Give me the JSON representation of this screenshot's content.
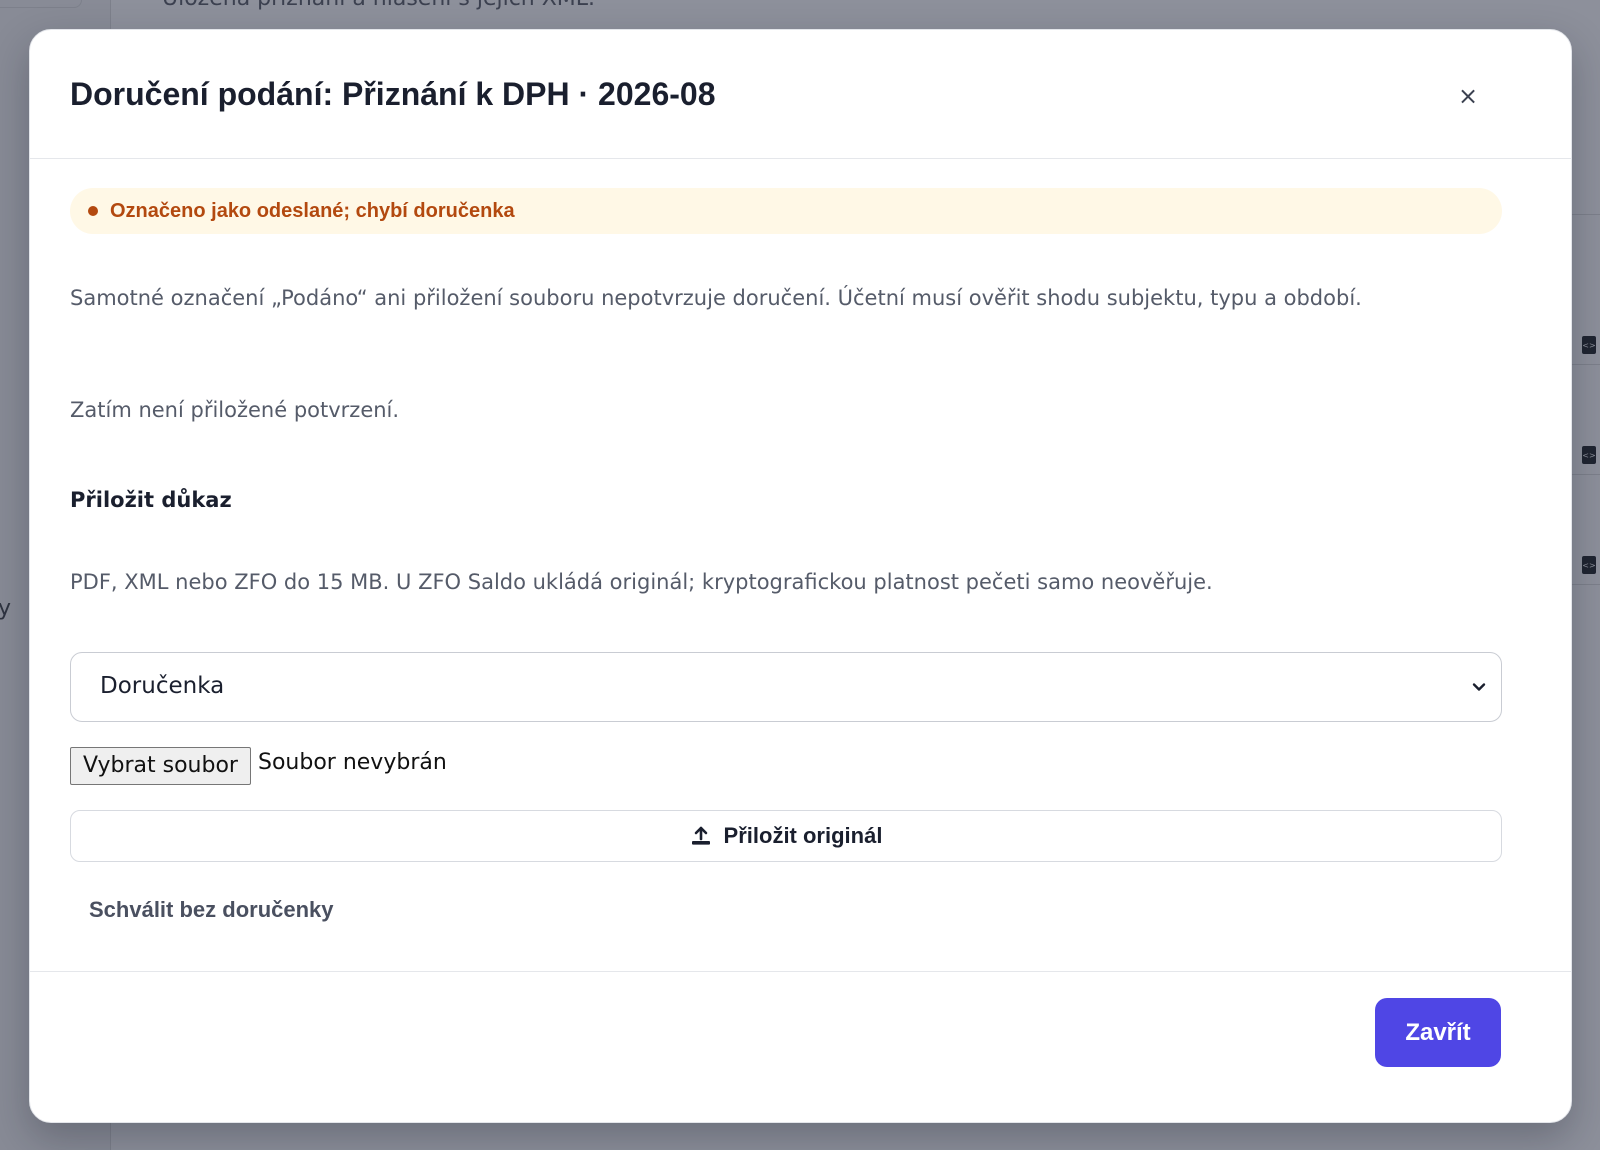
{
  "background": {
    "heading_fragment": "Uložená přiznání a hlášení s jejich XML.",
    "side_letter": "y"
  },
  "modal": {
    "title": "Doručení podání: Přiznání k DPH · 2026-08",
    "close_icon_glyph": "×",
    "status": {
      "text": "Označeno jako odeslané; chybí doručenka",
      "color": "#b3490f",
      "background": "#fff8e6"
    },
    "notice": "Samotné označení „Podáno“ ani přiložení souboru nepotvrzuje doručení. Účetní musí ověřit shodu subjektu, typu a období.",
    "empty_state": "Zatím není přiložené potvrzení.",
    "attach_section": {
      "heading": "Přiložit důkaz",
      "hint": "PDF, XML nebo ZFO do 15 MB. U ZFO Saldo ukládá originál; kryptografickou platnost pečeti samo neověřuje.",
      "document_type": {
        "selected": "Doručenka"
      },
      "file_input": {
        "button_label": "Vybrat soubor",
        "status": "Soubor nevybrán"
      },
      "attach_button": {
        "label": "Přiložit originál",
        "icon": "upload-icon"
      },
      "approve_without_receipt": "Schválit bez doručenky"
    },
    "footer": {
      "close_label": "Zavřít",
      "accent": "#4f46e5"
    }
  }
}
